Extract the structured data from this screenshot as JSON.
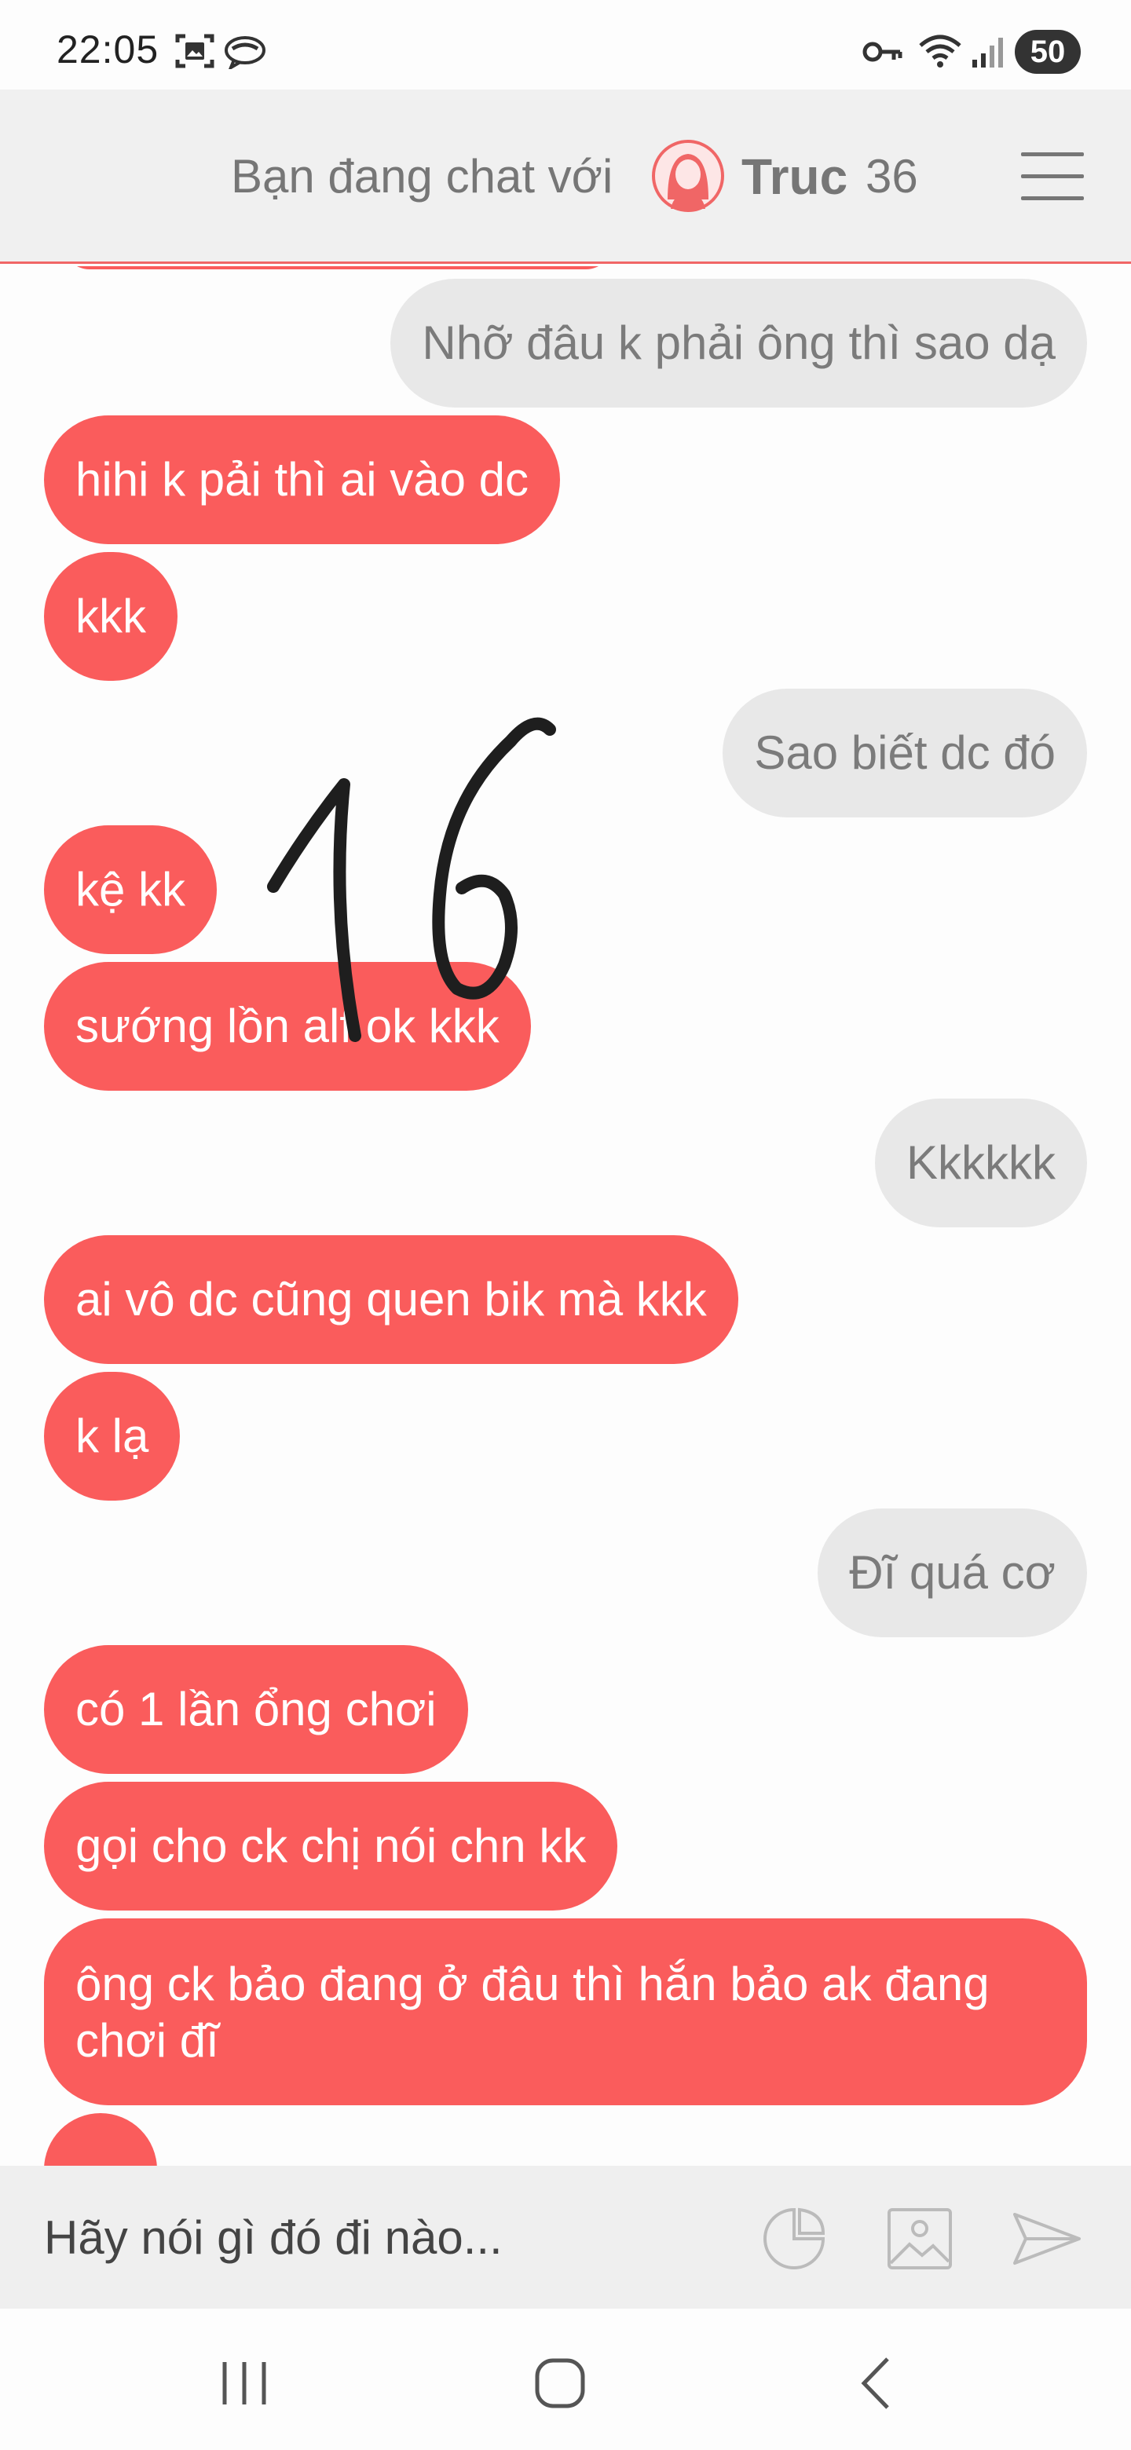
{
  "status_bar": {
    "time": "22:05",
    "battery": "50",
    "icons": [
      "screenshot-icon",
      "messenger-icon",
      "key-icon",
      "wifi-icon",
      "signal-icon",
      "battery-icon"
    ]
  },
  "header": {
    "prefix": "Bạn đang chat với",
    "name": "Truc",
    "age": "36",
    "avatar_icon": "female-avatar-icon",
    "menu_icon": "hamburger-menu-icon"
  },
  "chat": {
    "messages": [
      {
        "side": "out",
        "text": "Nhỡ đâu k phải ông thì sao dạ"
      },
      {
        "side": "in",
        "text": "hihi k pải thì ai vào dc"
      },
      {
        "side": "in",
        "text": "kkk"
      },
      {
        "side": "out",
        "text": "Sao biết dc đó"
      },
      {
        "side": "in",
        "text": "kệ kk"
      },
      {
        "side": "in",
        "text": "sướng lồn alf ok kkk"
      },
      {
        "side": "out",
        "text": "Kkkkkk"
      },
      {
        "side": "in",
        "text": "ai vô dc cũng quen bik mà kkk"
      },
      {
        "side": "in",
        "text": "k lạ"
      },
      {
        "side": "out",
        "text": "Đĩ quá cơ"
      },
      {
        "side": "in",
        "text": "có 1 lần ổng chơi"
      },
      {
        "side": "in",
        "text": "gọi cho ck chị nói chn kk"
      },
      {
        "side": "in",
        "text": "ông ck bảo đang ở đâu thì hắn bảo ak đang chơi đĩ"
      }
    ],
    "handwritten_overlay": "16"
  },
  "input": {
    "placeholder": "Hãy nói gì đó đi nào...",
    "icons": [
      "sticker-icon",
      "image-icon",
      "send-icon"
    ]
  },
  "nav": {
    "icons": [
      "recent-apps-icon",
      "home-icon",
      "back-icon"
    ]
  },
  "colors": {
    "incoming_bubble": "#fa5c5c",
    "outgoing_bubble": "#e8e8e8",
    "header_bg": "#f0f0f0",
    "accent_line": "#f06666"
  }
}
